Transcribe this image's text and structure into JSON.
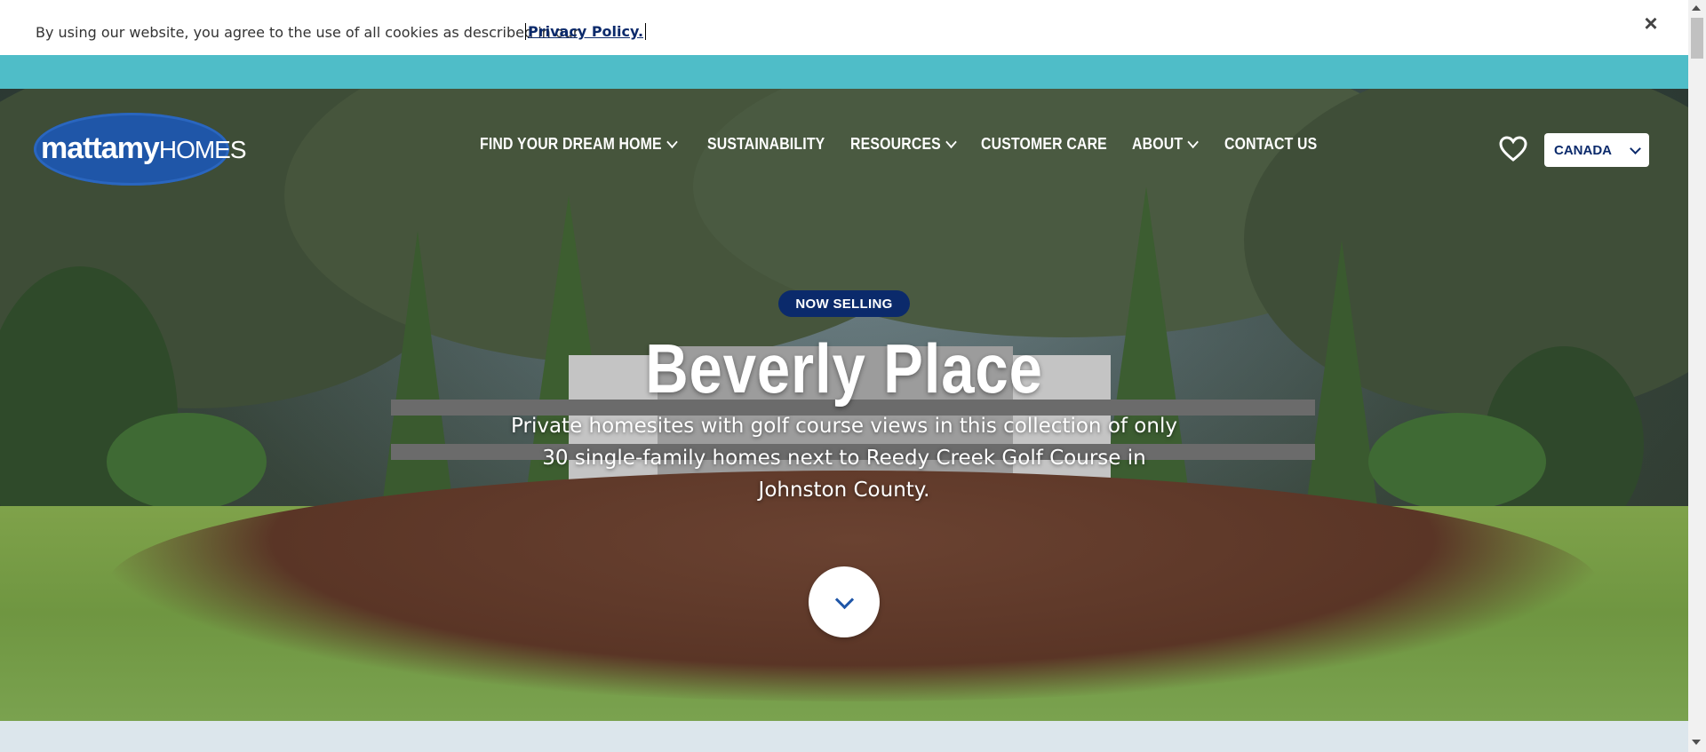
{
  "cookie": {
    "message": "By using our website, you agree to the use of all cookies as described in our",
    "link": "Privacy Policy.",
    "close": "×"
  },
  "brand": {
    "logo_bold": "mattamy",
    "logo_light": "HOMES",
    "primary_color": "#0b2a6b",
    "logo_color": "#1f56a8",
    "banner_color": "#4fbdc8"
  },
  "nav": {
    "items": [
      {
        "label": "FIND YOUR DREAM HOME",
        "has_dropdown": true
      },
      {
        "label": "SUSTAINABILITY",
        "has_dropdown": false
      },
      {
        "label": "RESOURCES",
        "has_dropdown": true
      },
      {
        "label": "CUSTOMER CARE",
        "has_dropdown": false
      },
      {
        "label": "ABOUT",
        "has_dropdown": true
      },
      {
        "label": "CONTACT US",
        "has_dropdown": false
      }
    ],
    "favorites_icon": "heart-icon",
    "country": "CANADA"
  },
  "hero": {
    "badge": "NOW SELLING",
    "title": "Beverly Place",
    "subtitle": "Private homesites with golf course views in this collection of only 30 single-family homes next to Reedy Creek Golf Course in Johnston County.",
    "scroll_icon": "chevron-down-icon"
  }
}
